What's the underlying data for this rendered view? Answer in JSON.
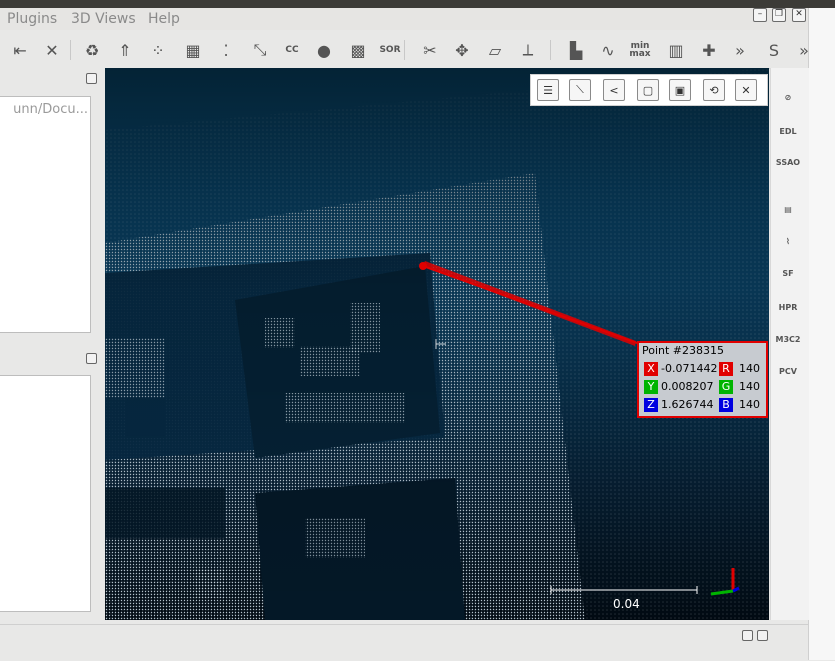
{
  "menu": {
    "plugins": "Plugins",
    "views": "3D Views",
    "help": "Help"
  },
  "window_controls": {
    "minimize": "–",
    "restore": "❐",
    "close": "✕"
  },
  "toolbar": {
    "items": [
      {
        "name": "segment-icon",
        "glyph": "⇤"
      },
      {
        "name": "delete-icon",
        "glyph": "✕"
      },
      {
        "name": "merge-icon",
        "glyph": "♻"
      },
      {
        "name": "normals-icon",
        "glyph": "⇑"
      },
      {
        "name": "subsample-icon",
        "glyph": "⁘"
      },
      {
        "name": "cloud-icon",
        "glyph": "▦"
      },
      {
        "name": "noise-icon",
        "glyph": "⁚"
      },
      {
        "name": "resample-icon",
        "glyph": "⤡"
      },
      {
        "name": "cc-icon",
        "glyph": "CC"
      },
      {
        "name": "color-icon",
        "glyph": "●"
      },
      {
        "name": "checker-icon",
        "glyph": "▩"
      },
      {
        "name": "sor-icon",
        "glyph": "SOR"
      },
      {
        "name": "scissors-icon",
        "glyph": "✂"
      },
      {
        "name": "translate-icon",
        "glyph": "✥"
      },
      {
        "name": "plane-icon",
        "glyph": "▱"
      },
      {
        "name": "axis-icon",
        "glyph": "⟂"
      },
      {
        "name": "histogram-icon",
        "glyph": "▙"
      },
      {
        "name": "gauss-icon",
        "glyph": "∿"
      },
      {
        "name": "minmax-icon",
        "glyph": "min max"
      },
      {
        "name": "trash-icon",
        "glyph": "▥"
      },
      {
        "name": "plus-icon",
        "glyph": "✚"
      },
      {
        "name": "overflow-icon",
        "glyph": "»"
      },
      {
        "name": "s-icon",
        "glyph": "S"
      },
      {
        "name": "overflow2-icon",
        "glyph": "»"
      }
    ]
  },
  "db_tree": {
    "path": "unn/Docu..."
  },
  "viewport_toolbar": [
    {
      "name": "label-list-icon",
      "glyph": "☰"
    },
    {
      "name": "line-tool-icon",
      "glyph": "⟍"
    },
    {
      "name": "share-icon",
      "glyph": "<"
    },
    {
      "name": "frame-icon",
      "glyph": "▢"
    },
    {
      "name": "save-icon",
      "glyph": "▣"
    },
    {
      "name": "reset-icon",
      "glyph": "⟲"
    },
    {
      "name": "close-icon",
      "glyph": "✕"
    }
  ],
  "side_tools": [
    {
      "name": "stop-icon",
      "glyph": "⊘"
    },
    {
      "name": "edl-icon",
      "glyph": "EDL"
    },
    {
      "name": "ssao-icon",
      "glyph": "SSAO"
    },
    {
      "name": "film-icon",
      "glyph": "▤"
    },
    {
      "name": "brush-icon",
      "glyph": "⌇"
    },
    {
      "name": "sf-icon",
      "glyph": "SF"
    },
    {
      "name": "hpr-icon",
      "glyph": "HPR"
    },
    {
      "name": "m3c2-icon",
      "glyph": "M3C2"
    },
    {
      "name": "pcv-icon",
      "glyph": "PCV"
    }
  ],
  "point_label": {
    "title": "Point #238315",
    "x_label": "X",
    "x_value": "-0.071442",
    "y_label": "Y",
    "y_value": "0.008207",
    "z_label": "Z",
    "z_value": "1.626744",
    "r_label": "R",
    "r_value": "140",
    "g_label": "G",
    "g_value": "140",
    "b_label": "B",
    "b_value": "140"
  },
  "scale_bar": {
    "label": "0.04"
  },
  "colors": {
    "viewport_top": "#0a5785",
    "viewport_bottom": "#010a12",
    "label_border": "#e10000",
    "x_red": "#e10000",
    "y_green": "#00b400",
    "z_blue": "#0000e0"
  }
}
